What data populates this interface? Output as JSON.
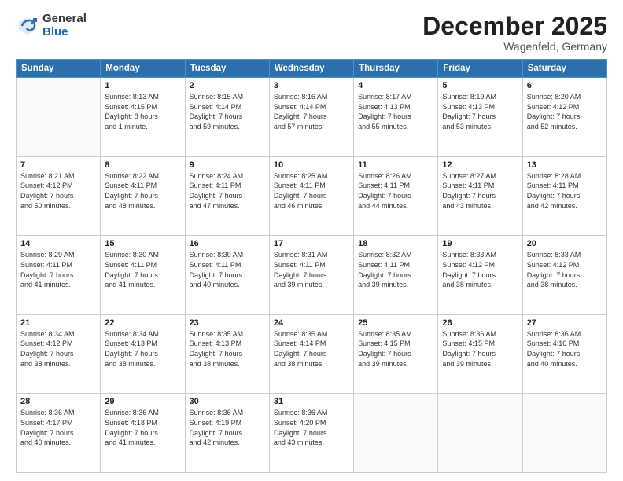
{
  "logo": {
    "general": "General",
    "blue": "Blue"
  },
  "header": {
    "month": "December 2025",
    "location": "Wagenfeld, Germany"
  },
  "weekdays": [
    "Sunday",
    "Monday",
    "Tuesday",
    "Wednesday",
    "Thursday",
    "Friday",
    "Saturday"
  ],
  "weeks": [
    [
      {
        "day": "",
        "info": ""
      },
      {
        "day": "1",
        "info": "Sunrise: 8:13 AM\nSunset: 4:15 PM\nDaylight: 8 hours\nand 1 minute."
      },
      {
        "day": "2",
        "info": "Sunrise: 8:15 AM\nSunset: 4:14 PM\nDaylight: 7 hours\nand 59 minutes."
      },
      {
        "day": "3",
        "info": "Sunrise: 8:16 AM\nSunset: 4:14 PM\nDaylight: 7 hours\nand 57 minutes."
      },
      {
        "day": "4",
        "info": "Sunrise: 8:17 AM\nSunset: 4:13 PM\nDaylight: 7 hours\nand 55 minutes."
      },
      {
        "day": "5",
        "info": "Sunrise: 8:19 AM\nSunset: 4:13 PM\nDaylight: 7 hours\nand 53 minutes."
      },
      {
        "day": "6",
        "info": "Sunrise: 8:20 AM\nSunset: 4:12 PM\nDaylight: 7 hours\nand 52 minutes."
      }
    ],
    [
      {
        "day": "7",
        "info": "Sunrise: 8:21 AM\nSunset: 4:12 PM\nDaylight: 7 hours\nand 50 minutes."
      },
      {
        "day": "8",
        "info": "Sunrise: 8:22 AM\nSunset: 4:11 PM\nDaylight: 7 hours\nand 48 minutes."
      },
      {
        "day": "9",
        "info": "Sunrise: 8:24 AM\nSunset: 4:11 PM\nDaylight: 7 hours\nand 47 minutes."
      },
      {
        "day": "10",
        "info": "Sunrise: 8:25 AM\nSunset: 4:11 PM\nDaylight: 7 hours\nand 46 minutes."
      },
      {
        "day": "11",
        "info": "Sunrise: 8:26 AM\nSunset: 4:11 PM\nDaylight: 7 hours\nand 44 minutes."
      },
      {
        "day": "12",
        "info": "Sunrise: 8:27 AM\nSunset: 4:11 PM\nDaylight: 7 hours\nand 43 minutes."
      },
      {
        "day": "13",
        "info": "Sunrise: 8:28 AM\nSunset: 4:11 PM\nDaylight: 7 hours\nand 42 minutes."
      }
    ],
    [
      {
        "day": "14",
        "info": "Sunrise: 8:29 AM\nSunset: 4:11 PM\nDaylight: 7 hours\nand 41 minutes."
      },
      {
        "day": "15",
        "info": "Sunrise: 8:30 AM\nSunset: 4:11 PM\nDaylight: 7 hours\nand 41 minutes."
      },
      {
        "day": "16",
        "info": "Sunrise: 8:30 AM\nSunset: 4:11 PM\nDaylight: 7 hours\nand 40 minutes."
      },
      {
        "day": "17",
        "info": "Sunrise: 8:31 AM\nSunset: 4:11 PM\nDaylight: 7 hours\nand 39 minutes."
      },
      {
        "day": "18",
        "info": "Sunrise: 8:32 AM\nSunset: 4:11 PM\nDaylight: 7 hours\nand 39 minutes."
      },
      {
        "day": "19",
        "info": "Sunrise: 8:33 AM\nSunset: 4:12 PM\nDaylight: 7 hours\nand 38 minutes."
      },
      {
        "day": "20",
        "info": "Sunrise: 8:33 AM\nSunset: 4:12 PM\nDaylight: 7 hours\nand 38 minutes."
      }
    ],
    [
      {
        "day": "21",
        "info": "Sunrise: 8:34 AM\nSunset: 4:12 PM\nDaylight: 7 hours\nand 38 minutes."
      },
      {
        "day": "22",
        "info": "Sunrise: 8:34 AM\nSunset: 4:13 PM\nDaylight: 7 hours\nand 38 minutes."
      },
      {
        "day": "23",
        "info": "Sunrise: 8:35 AM\nSunset: 4:13 PM\nDaylight: 7 hours\nand 38 minutes."
      },
      {
        "day": "24",
        "info": "Sunrise: 8:35 AM\nSunset: 4:14 PM\nDaylight: 7 hours\nand 38 minutes."
      },
      {
        "day": "25",
        "info": "Sunrise: 8:35 AM\nSunset: 4:15 PM\nDaylight: 7 hours\nand 39 minutes."
      },
      {
        "day": "26",
        "info": "Sunrise: 8:36 AM\nSunset: 4:15 PM\nDaylight: 7 hours\nand 39 minutes."
      },
      {
        "day": "27",
        "info": "Sunrise: 8:36 AM\nSunset: 4:16 PM\nDaylight: 7 hours\nand 40 minutes."
      }
    ],
    [
      {
        "day": "28",
        "info": "Sunrise: 8:36 AM\nSunset: 4:17 PM\nDaylight: 7 hours\nand 40 minutes."
      },
      {
        "day": "29",
        "info": "Sunrise: 8:36 AM\nSunset: 4:18 PM\nDaylight: 7 hours\nand 41 minutes."
      },
      {
        "day": "30",
        "info": "Sunrise: 8:36 AM\nSunset: 4:19 PM\nDaylight: 7 hours\nand 42 minutes."
      },
      {
        "day": "31",
        "info": "Sunrise: 8:36 AM\nSunset: 4:20 PM\nDaylight: 7 hours\nand 43 minutes."
      },
      {
        "day": "",
        "info": ""
      },
      {
        "day": "",
        "info": ""
      },
      {
        "day": "",
        "info": ""
      }
    ]
  ]
}
